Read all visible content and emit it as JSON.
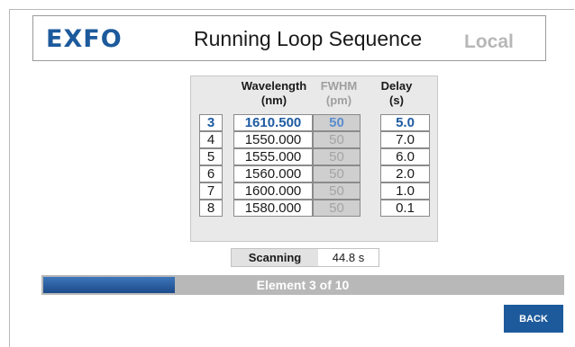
{
  "header": {
    "logo": "EXFO",
    "title": "Running Loop Sequence",
    "mode": "Local"
  },
  "table": {
    "headers": {
      "wavelength": "Wavelength\n(nm)",
      "fwhm": "FWHM\n(pm)",
      "delay": "Delay\n(s)"
    },
    "rows": [
      {
        "index": "3",
        "wavelength": "1610.500",
        "fwhm": "50",
        "delay": "5.0",
        "active": true
      },
      {
        "index": "4",
        "wavelength": "1550.000",
        "fwhm": "50",
        "delay": "7.0"
      },
      {
        "index": "5",
        "wavelength": "1555.000",
        "fwhm": "50",
        "delay": "6.0"
      },
      {
        "index": "6",
        "wavelength": "1560.000",
        "fwhm": "50",
        "delay": "2.0"
      },
      {
        "index": "7",
        "wavelength": "1600.000",
        "fwhm": "50",
        "delay": "1.0"
      },
      {
        "index": "8",
        "wavelength": "1580.000",
        "fwhm": "50",
        "delay": "0.1"
      }
    ]
  },
  "status": {
    "label": "Scanning",
    "value": "44.8 s"
  },
  "progress": {
    "text": "Element 3 of 10",
    "fraction": 0.255
  },
  "buttons": {
    "back": "BACK"
  },
  "colors": {
    "brand": "#1d5a9c",
    "active_text": "#1d5aa2",
    "progress_track": "#b8b8b8"
  }
}
